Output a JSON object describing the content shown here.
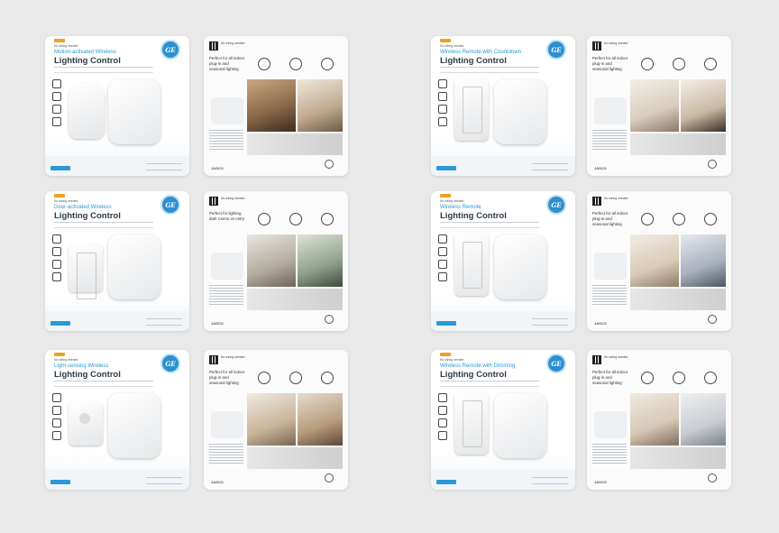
{
  "brand_logo": "GE",
  "packages": [
    {
      "row": 0,
      "col": 0,
      "front": {
        "no_wiring": "No wiring needed",
        "subtitle": "Motion-activated Wireless",
        "title": "Lighting Control",
        "device": "round"
      },
      "back": {
        "no_wiring": "No wiring needed",
        "perfect_for": "Perfect for all indoor plug-in and seasonal lighting",
        "range": "150ft.",
        "brand": "JASCO"
      }
    },
    {
      "row": 0,
      "col": 1,
      "front": {
        "no_wiring": "No wiring needed",
        "subtitle": "Wireless Remote with Countdown",
        "title": "Lighting Control",
        "device": "switch"
      },
      "back": {
        "no_wiring": "No wiring needed",
        "perfect_for": "Perfect for all indoor plug-in and seasonal lighting",
        "range": "150ft.",
        "brand": "JASCO"
      }
    },
    {
      "row": 1,
      "col": 0,
      "front": {
        "no_wiring": "No wiring needed",
        "subtitle": "Door-activated Wireless",
        "title": "Lighting Control",
        "device": "switch"
      },
      "back": {
        "no_wiring": "No wiring needed",
        "perfect_for": "Perfect for lighting dark rooms on entry",
        "range": "150ft.",
        "brand": "JASCO"
      }
    },
    {
      "row": 1,
      "col": 1,
      "front": {
        "no_wiring": "No wiring needed",
        "subtitle": "Wireless Remote",
        "title": "Lighting Control",
        "device": "switch"
      },
      "back": {
        "no_wiring": "No wiring needed",
        "perfect_for": "Perfect for all indoor plug-in and seasonal lighting",
        "range": "150ft.",
        "brand": "JASCO"
      }
    },
    {
      "row": 2,
      "col": 0,
      "front": {
        "no_wiring": "No wiring needed",
        "subtitle": "Light-sensing Wireless",
        "title": "Lighting Control",
        "device": "sensor"
      },
      "back": {
        "no_wiring": "No wiring needed",
        "perfect_for": "Perfect for all indoor plug-in and seasonal lighting",
        "range": "150ft.",
        "brand": "JASCO"
      }
    },
    {
      "row": 2,
      "col": 1,
      "front": {
        "no_wiring": "No wiring needed",
        "subtitle": "Wireless Remote with Dimming",
        "title": "Lighting Control",
        "device": "switch"
      },
      "back": {
        "no_wiring": "No wiring needed",
        "perfect_for": "Perfect for all indoor plug-in and seasonal lighting",
        "range": "150ft.",
        "brand": "JASCO"
      }
    }
  ]
}
